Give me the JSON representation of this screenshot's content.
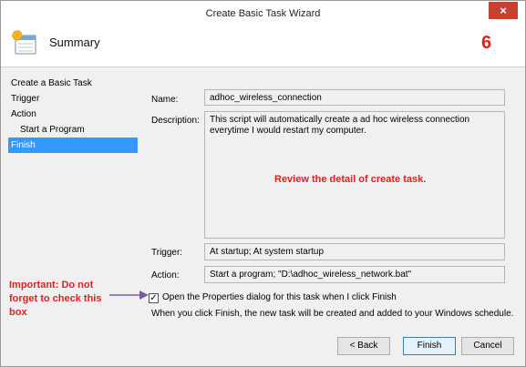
{
  "window": {
    "title": "Create Basic Task Wizard",
    "close_label": "×"
  },
  "header": {
    "title": "Summary",
    "step_number": "6"
  },
  "sidebar": {
    "items": [
      {
        "label": "Create a Basic Task"
      },
      {
        "label": "Trigger"
      },
      {
        "label": "Action"
      },
      {
        "label": "Start a Program"
      },
      {
        "label": "Finish"
      }
    ]
  },
  "form": {
    "name_label": "Name:",
    "name_value": "adhoc_wireless_connection",
    "description_label": "Description:",
    "description_value": "This script will automatically create a ad hoc wireless connection everytime I would restart my computer.",
    "trigger_label": "Trigger:",
    "trigger_value": "At startup; At system startup",
    "action_label": "Action:",
    "action_value": "Start a program; \"D:\\adhoc_wireless_network.bat\"",
    "open_properties_label": "Open the Properties dialog for this task when I click Finish",
    "open_properties_checked": true,
    "info_text": "When you click Finish, the new task will be created and added to your Windows schedule."
  },
  "annotations": {
    "review": "Review the detail of create task.",
    "important": "Important: Do not forget to check this box",
    "color": "#e02020"
  },
  "buttons": {
    "back": "< Back",
    "finish": "Finish",
    "cancel": "Cancel"
  },
  "colors": {
    "selection": "#3399ff",
    "close": "#c84031",
    "annotation": "#e02020"
  }
}
